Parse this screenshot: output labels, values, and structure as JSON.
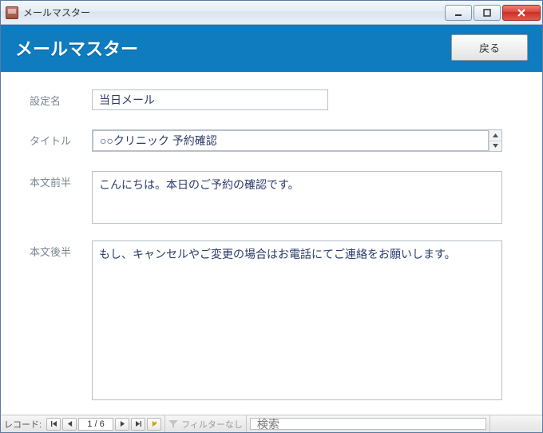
{
  "window": {
    "title": "メールマスター"
  },
  "banner": {
    "title": "メールマスター",
    "back_label": "戻る"
  },
  "form": {
    "setting_name_label": "設定名",
    "setting_name_value": "当日メール",
    "title_label": "タイトル",
    "title_value": "○○クリニック 予約確認",
    "body_first_label": "本文前半",
    "body_first_value": "こんにちは。本日のご予約の確認です。",
    "body_second_label": "本文後半",
    "body_second_value": "もし、キャンセルやご変更の場合はお電話にてご連絡をお願いします。"
  },
  "statusbar": {
    "record_label": "レコード:",
    "position": "1 / 6",
    "filter_text": "フィルターなし",
    "search_placeholder": "検索"
  }
}
